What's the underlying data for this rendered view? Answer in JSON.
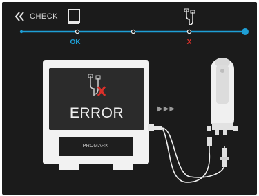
{
  "header": {
    "back_icon": "double-chevron-left-icon",
    "title": "CHECK"
  },
  "progress": {
    "steps": [
      {
        "id": "device",
        "icon": "device-icon",
        "status_label": "OK",
        "status_color": "#1e9fd6"
      },
      {
        "id": "cable",
        "icon": "cable-icon",
        "status_label": "X",
        "status_color": "#d9302a"
      }
    ],
    "accent_color": "#1e9fd6"
  },
  "device": {
    "screen_message": "ERROR",
    "screen_icon": "cable-error-icon",
    "brand_label": "PROMARK"
  },
  "flow_indicator": "▶▶▶",
  "accessory": {
    "icon": "handset-icon"
  }
}
